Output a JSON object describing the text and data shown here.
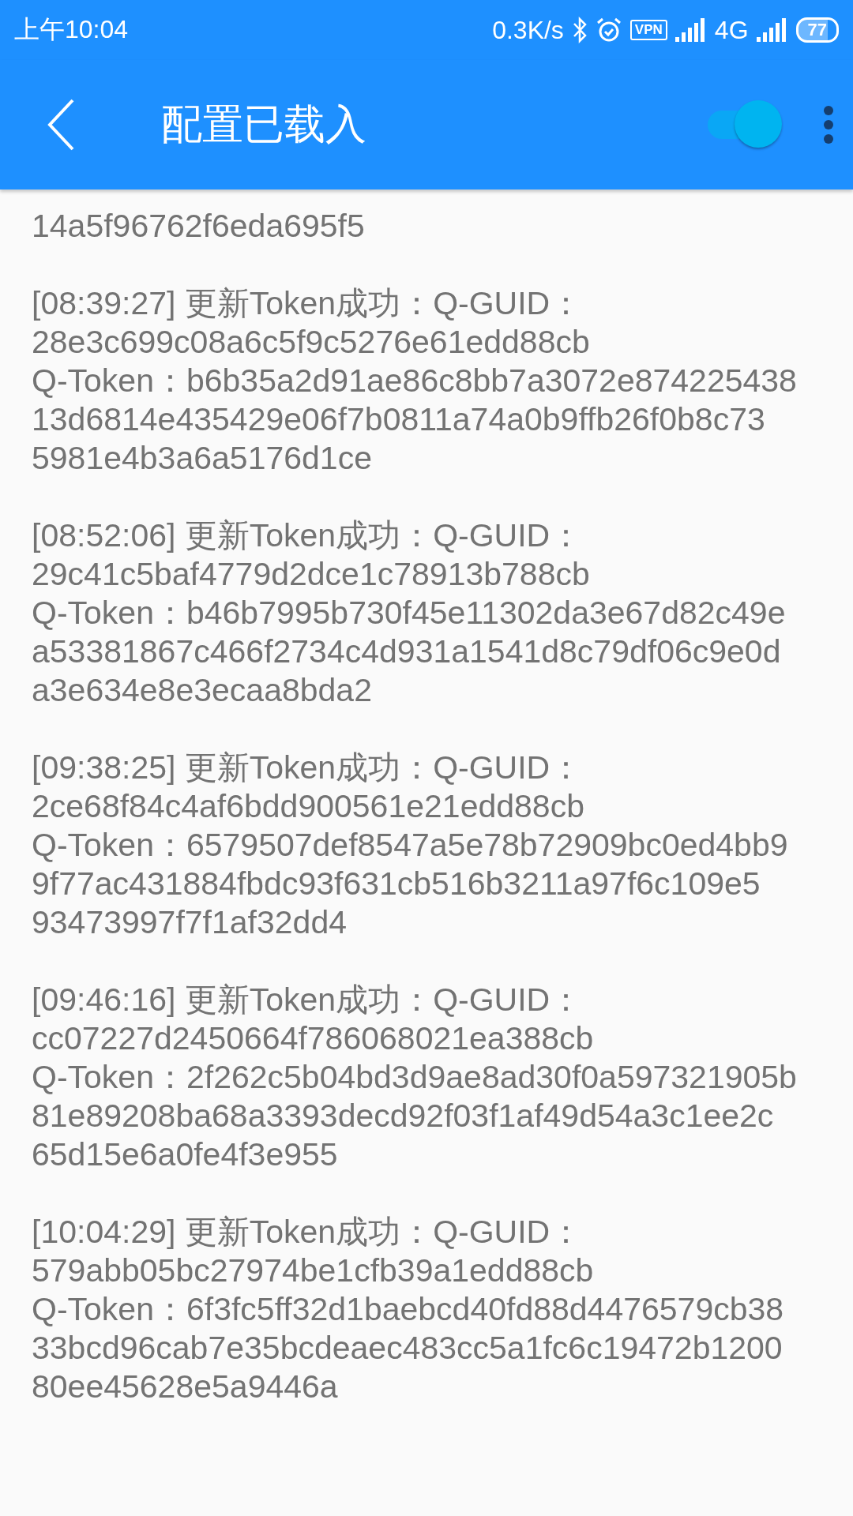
{
  "status_bar": {
    "time": "上午10:04",
    "net_speed": "0.3K/s",
    "vpn": "VPN",
    "network": "4G",
    "battery": "77"
  },
  "app_bar": {
    "title": "配置已载入",
    "switch": {
      "on": true
    }
  },
  "log": [
    {
      "lines": [
        "14a5f96762f6eda695f5"
      ]
    },
    {
      "lines": [
        "[08:39:27] 更新Token成功：Q-GUID：",
        "28e3c699c08a6c5f9c5276e61edd88cb",
        "Q-Token：b6b35a2d91ae86c8bb7a3072e874225438",
        "13d6814e435429e06f7b0811a74a0b9ffb26f0b8c73",
        "5981e4b3a6a5176d1ce"
      ]
    },
    {
      "lines": [
        "[08:52:06] 更新Token成功：Q-GUID：",
        "29c41c5baf4779d2dce1c78913b788cb",
        "Q-Token：b46b7995b730f45e11302da3e67d82c49e",
        "a53381867c466f2734c4d931a1541d8c79df06c9e0d",
        "a3e634e8e3ecaa8bda2"
      ]
    },
    {
      "lines": [
        "[09:38:25] 更新Token成功：Q-GUID：",
        "2ce68f84c4af6bdd900561e21edd88cb",
        "Q-Token：6579507def8547a5e78b72909bc0ed4bb9",
        "9f77ac431884fbdc93f631cb516b3211a97f6c109e5",
        "93473997f7f1af32dd4"
      ]
    },
    {
      "lines": [
        "[09:46:16] 更新Token成功：Q-GUID：",
        "cc07227d2450664f786068021ea388cb",
        "Q-Token：2f262c5b04bd3d9ae8ad30f0a597321905b",
        "81e89208ba68a3393decd92f03f1af49d54a3c1ee2c",
        "65d15e6a0fe4f3e955"
      ]
    },
    {
      "lines": [
        "[10:04:29] 更新Token成功：Q-GUID：",
        "579abb05bc27974be1cfb39a1edd88cb",
        "Q-Token：6f3fc5ff32d1baebcd40fd88d4476579cb38",
        "33bcd96cab7e35bcdeaec483cc5a1fc6c19472b1200",
        "80ee45628e5a9446a"
      ]
    }
  ]
}
